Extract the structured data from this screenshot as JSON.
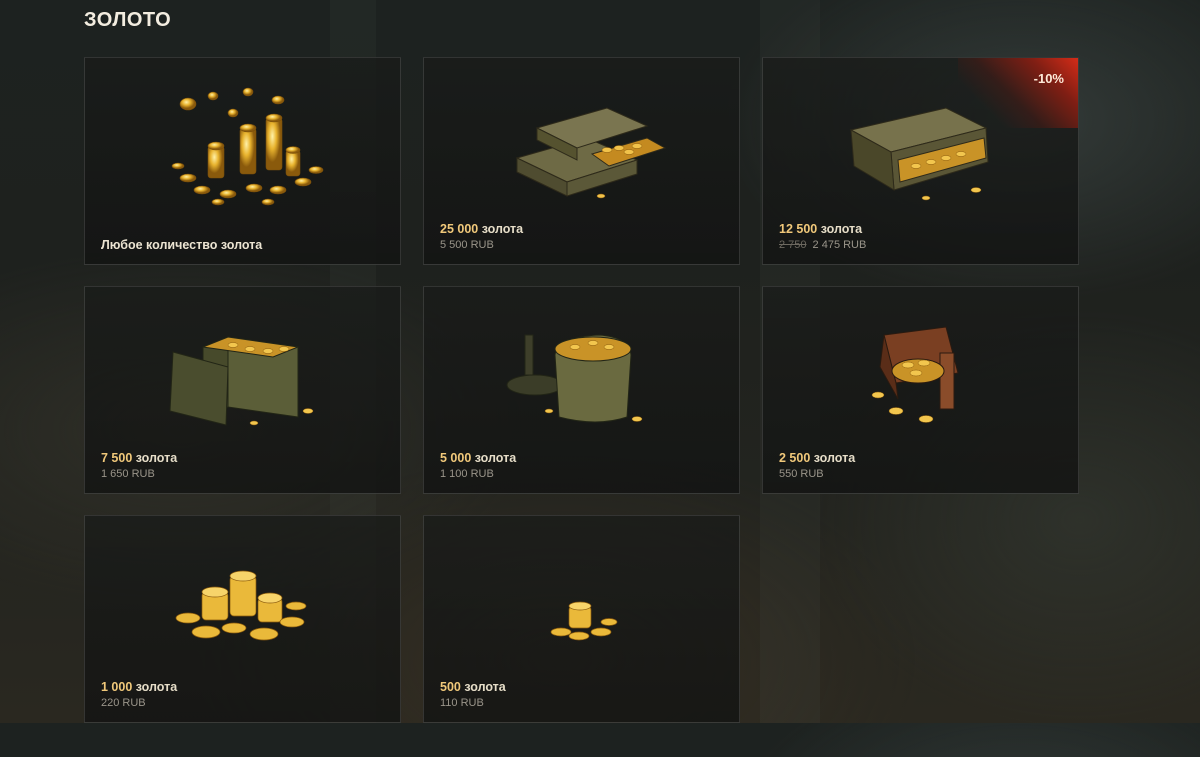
{
  "page": {
    "title": "ЗОЛОТО"
  },
  "cards": [
    {
      "label": "Любое количество золота",
      "image": "gold-coins-scattered-icon"
    },
    {
      "amount": "25 000",
      "unit": "золота",
      "price": "5 500 RUB",
      "image": "three-wooden-crates-icon"
    },
    {
      "amount": "12 500",
      "unit": "золота",
      "old_price": "2 750",
      "price": "2 475 RUB",
      "discount": "-10%",
      "image": "wooden-crate-icon"
    },
    {
      "amount": "7 500",
      "unit": "золота",
      "price": "1 650 RUB",
      "image": "ammo-box-icon"
    },
    {
      "amount": "5 000",
      "unit": "золота",
      "price": "1 100 RUB",
      "image": "mess-tin-icon"
    },
    {
      "amount": "2 500",
      "unit": "золота",
      "price": "550 RUB",
      "image": "leather-pouch-icon"
    },
    {
      "amount": "1 000",
      "unit": "золота",
      "price": "220 RUB",
      "image": "coin-stacks-icon"
    },
    {
      "amount": "500",
      "unit": "золота",
      "price": "110 RUB",
      "image": "small-coin-pile-icon"
    }
  ],
  "colors": {
    "gold": "#f0c87a",
    "badge_red": "#d42c18",
    "card_border": "#3a3a36"
  }
}
